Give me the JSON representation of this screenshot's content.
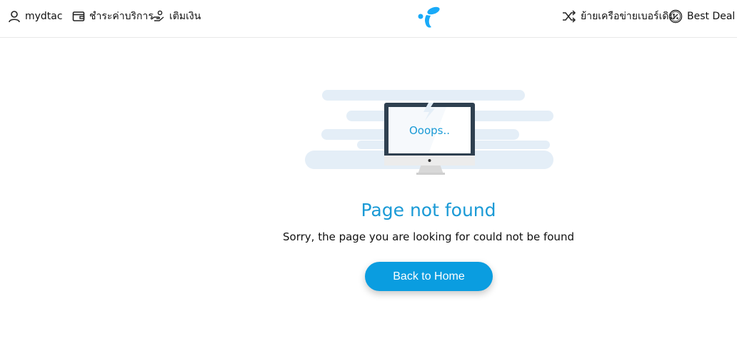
{
  "header": {
    "nav_left": [
      {
        "label": "mydtac",
        "icon": "user-icon"
      },
      {
        "label": "ชำระค่าบริการ",
        "icon": "wallet-icon"
      },
      {
        "label": "เติมเงิน",
        "icon": "topup-hand-icon"
      }
    ],
    "nav_right": [
      {
        "label": "ย้ายเครือข่ายเบอร์เดิม",
        "icon": "shuffle-icon"
      },
      {
        "label": "Best Deal",
        "icon": "percent-badge-icon"
      }
    ],
    "logo": "dtac-logo-icon"
  },
  "error": {
    "screen_text": "Ooops..",
    "title": "Page not found",
    "message": "Sorry, the page you are looking for could not be found",
    "button_label": "Back to Home"
  },
  "colors": {
    "accent": "#1a9ad6",
    "button": "#0a9de0",
    "cloud": "#e4eef7",
    "monitor_frame": "#2f4050"
  }
}
